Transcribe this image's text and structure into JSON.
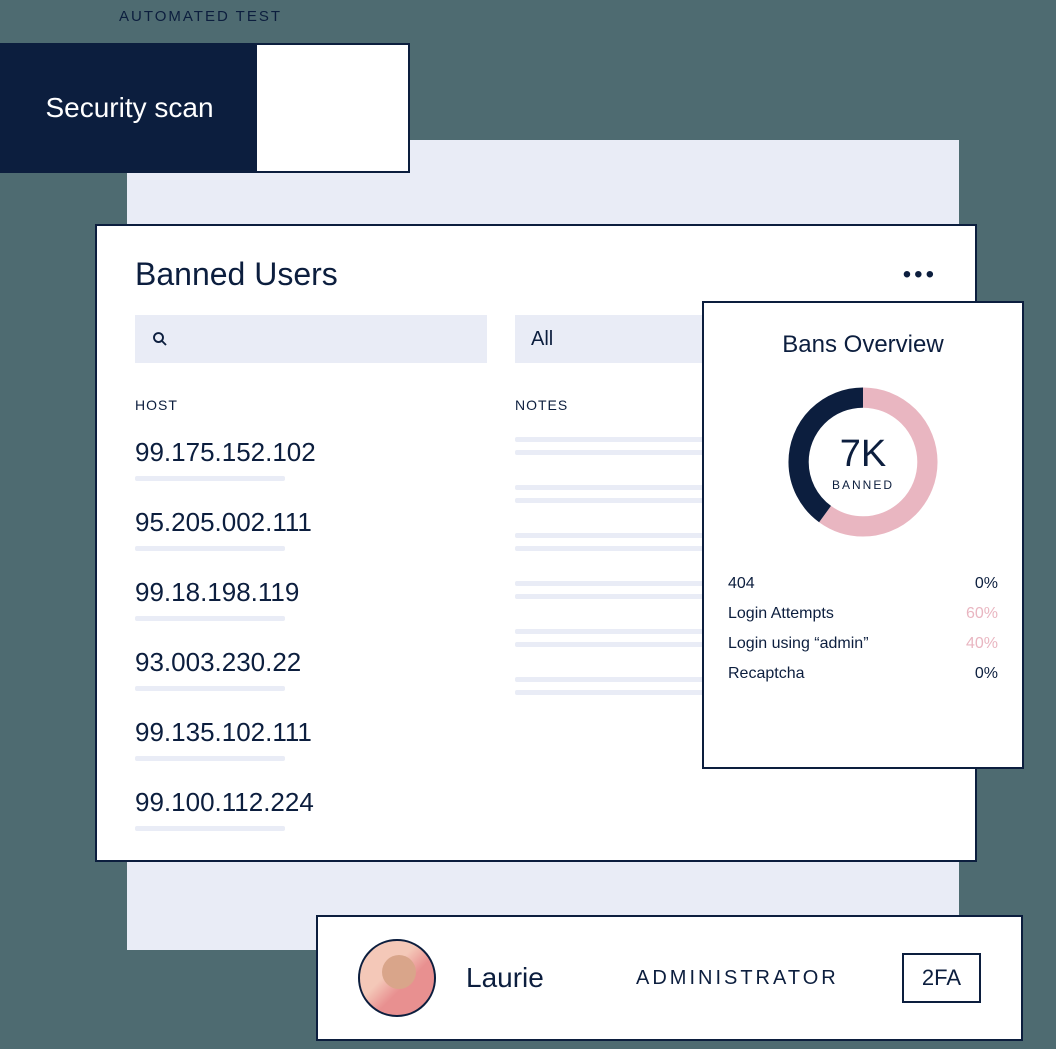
{
  "labels": {
    "automated_test": "AUTOMATED TEST"
  },
  "security_card": {
    "title": "Security scan"
  },
  "banned_users": {
    "title": "Banned Users",
    "filter_all": "All",
    "columns": {
      "host": "HOST",
      "notes": "NOTES"
    },
    "hosts": [
      "99.175.152.102",
      "95.205.002.111",
      "99.18.198.119",
      "93.003.230.22",
      "99.135.102.111",
      "99.100.112.224"
    ]
  },
  "bans_overview": {
    "title": "Bans Overview",
    "count": "7K",
    "count_label": "BANNED",
    "stats": [
      {
        "label": "404",
        "value": "0%",
        "pink": false
      },
      {
        "label": "Login Attempts",
        "value": "60%",
        "pink": true
      },
      {
        "label": "Login using “admin”",
        "value": "40%",
        "pink": true
      },
      {
        "label": "Recaptcha",
        "value": "0%",
        "pink": false
      }
    ]
  },
  "user_card": {
    "name": "Laurie",
    "role": "ADMINISTRATOR",
    "twofa": "2FA"
  },
  "chart_data": {
    "type": "pie",
    "title": "Bans Overview",
    "total_label": "7K BANNED",
    "series": [
      {
        "name": "404",
        "value": 0
      },
      {
        "name": "Login Attempts",
        "value": 60
      },
      {
        "name": "Login using “admin”",
        "value": 40
      },
      {
        "name": "Recaptcha",
        "value": 0
      }
    ],
    "colors": {
      "Login Attempts": "#e9b6c1",
      "Login using “admin”": "#0c1e3e"
    }
  }
}
